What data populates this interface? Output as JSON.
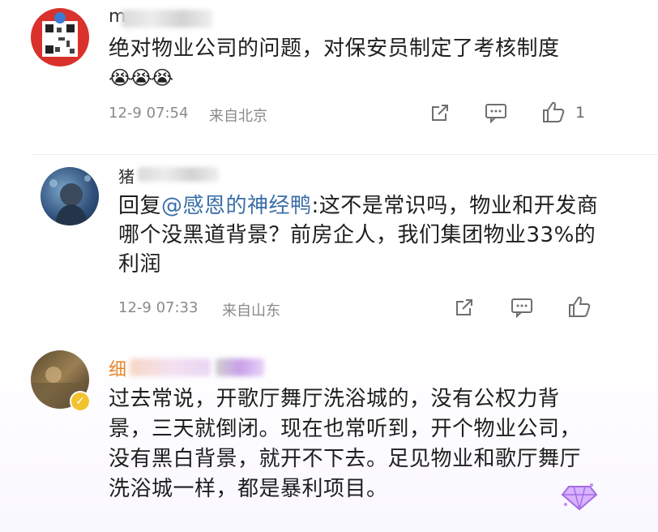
{
  "comments": [
    {
      "username": "m",
      "text": "绝对物业公司的问题，对保安员制定了考核制度",
      "emoji": [
        "😭",
        "😭",
        "😭"
      ],
      "time": "12-9 07:54",
      "location": "来自北京",
      "like_count": "1"
    },
    {
      "username": "猪",
      "reply_prefix": "回复",
      "mention": "@感恩的神经鸭",
      "text": ":这不是常识吗，物业和开发商哪个没黑道背景？前房企人，我们集团物业33%的利润",
      "time": "12-9 07:33",
      "location": "来自山东"
    },
    {
      "username": "细",
      "text": "过去常说，开歌厅舞厅洗浴城的，没有公权力背景，三天就倒闭。现在也常听到，开个物业公司，没有黑白背景，就开不下去。足见物业和歌厅舞厅洗浴城一样，都是暴利项目。"
    }
  ],
  "colors": {
    "mention": "#3a6ea8",
    "vip_name": "#e6862a",
    "badge": "#f2c230"
  }
}
